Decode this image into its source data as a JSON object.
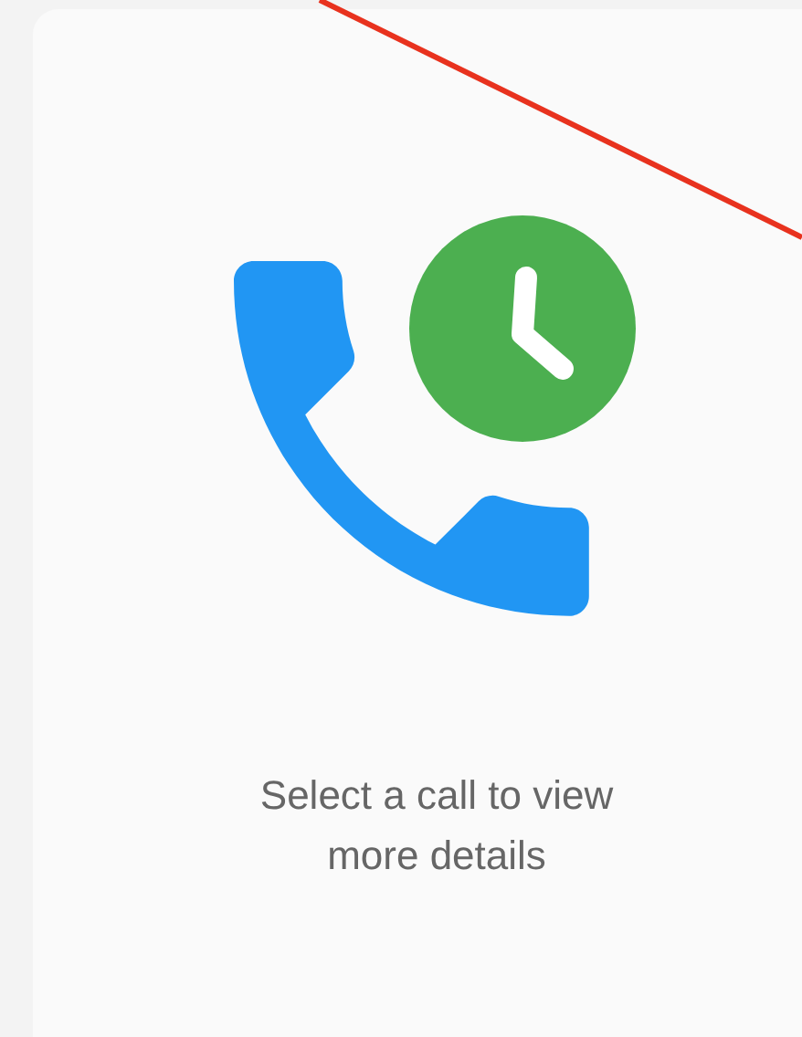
{
  "empty_state": {
    "message": "Select a call to view more details"
  }
}
